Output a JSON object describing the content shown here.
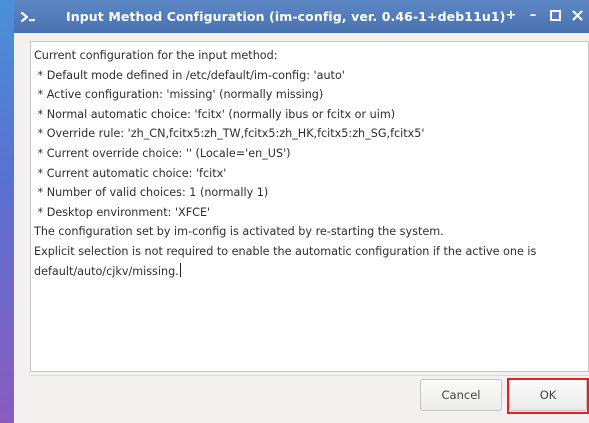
{
  "window": {
    "title": "Input Method Configuration (im-config, ver. 0.46-1+deb11u1)",
    "controls": {
      "pin": "+",
      "minimize": "–",
      "maximize": "□",
      "close": "×"
    }
  },
  "content": {
    "lines": [
      "Current configuration for the input method:",
      " * Default mode defined in /etc/default/im-config: 'auto'",
      " * Active configuration: 'missing' (normally missing)",
      " * Normal automatic choice: 'fcitx' (normally ibus or fcitx or uim)",
      " * Override rule: 'zh_CN,fcitx5:zh_TW,fcitx5:zh_HK,fcitx5:zh_SG,fcitx5'",
      " * Current override choice: '' (Locale='en_US')",
      " * Current automatic choice: 'fcitx'",
      " * Number of valid choices: 1 (normally 1)",
      " * Desktop environment: 'XFCE'",
      "The configuration set by im-config is activated by re-starting the system.",
      "Explicit selection is not required to enable the automatic configuration if the active one is default/auto/cjkv/missing."
    ]
  },
  "buttons": {
    "cancel": "Cancel",
    "ok": "OK"
  },
  "colors": {
    "titlebar": "#4a72b2",
    "highlight": "#d9252a"
  }
}
